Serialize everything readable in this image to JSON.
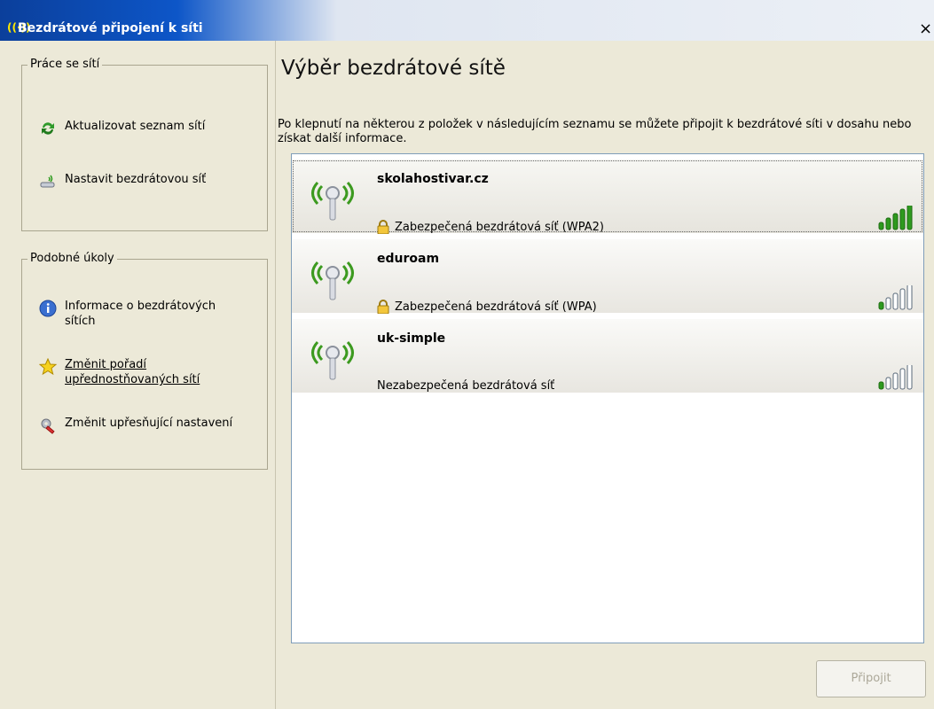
{
  "window": {
    "title": "Bezdrátové připojení k síti",
    "close_symbol": "×"
  },
  "sidebar": {
    "network_tasks": {
      "title": "Práce se sítí",
      "items": [
        {
          "label": "Aktualizovat seznam sítí",
          "icon": "refresh-icon"
        },
        {
          "label": "Nastavit bezdrátovou síť",
          "icon": "wireless-setup-icon"
        }
      ]
    },
    "related_tasks": {
      "title": "Podobné úkoly",
      "items": [
        {
          "label": "Informace o bezdrátových sítích",
          "icon": "info-icon"
        },
        {
          "label": "Změnit pořadí upřednostňovaných sítí",
          "icon": "star-icon"
        },
        {
          "label": "Změnit upřesňující nastavení",
          "icon": "settings-icon"
        }
      ]
    }
  },
  "main": {
    "heading": "Výběr bezdrátové sítě",
    "instructions": "Po klepnutí na některou z položek v následujícím seznamu se můžete připojit k bezdrátové síti v dosahu nebo získat další informace.",
    "networks": [
      {
        "name": "skolahostivar.cz",
        "security": "Zabezpečená bezdrátová síť (WPA2)",
        "secured": true,
        "signal_bars": 5,
        "selected": true
      },
      {
        "name": "eduroam",
        "security": "Zabezpečená bezdrátová síť (WPA)",
        "secured": true,
        "signal_bars": 1,
        "selected": false
      },
      {
        "name": "uk-simple",
        "security": "Nezabezpečená bezdrátová síť",
        "secured": false,
        "signal_bars": 1,
        "selected": false
      }
    ],
    "connect_label": "Připojit"
  },
  "colors": {
    "title_bar": "#0d56c8",
    "signal_on": "#2e9a1e",
    "signal_off": "#ffffff",
    "antenna_waves": "#3c9a1f"
  }
}
